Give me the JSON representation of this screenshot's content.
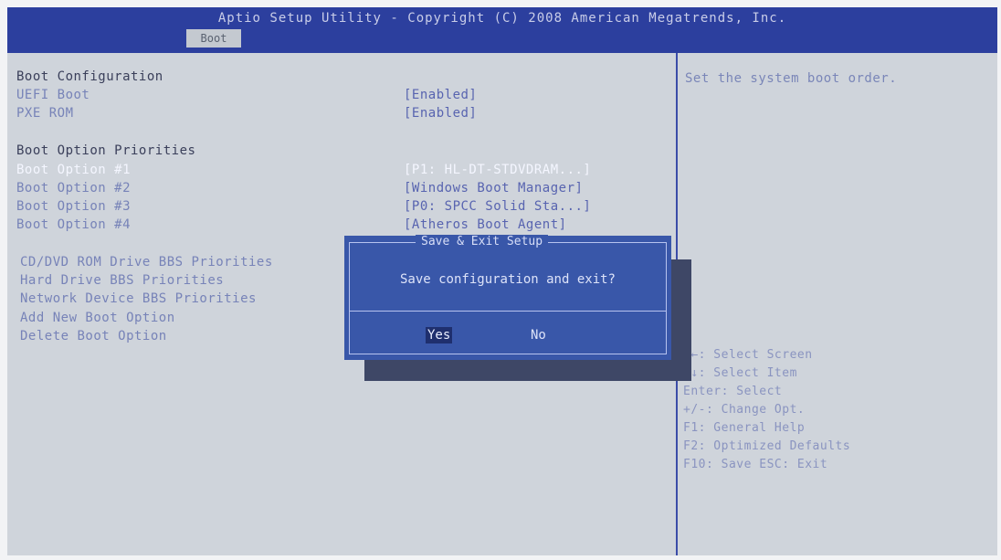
{
  "header": {
    "title": "Aptio Setup Utility - Copyright (C) 2008 American Megatrends, Inc.",
    "active_tab": "Boot"
  },
  "left": {
    "boot_config_heading": "Boot Configuration",
    "uefi_boot": {
      "label": "UEFI Boot",
      "value": "[Enabled]"
    },
    "pxe_rom": {
      "label": "PXE ROM",
      "value": "[Enabled]"
    },
    "priorities_heading": "Boot Option Priorities",
    "boot_options": [
      {
        "label": "Boot Option #1",
        "value": "[P1: HL-DT-STDVDRAM...]"
      },
      {
        "label": "Boot Option #2",
        "value": "[Windows Boot Manager]"
      },
      {
        "label": "Boot Option #3",
        "value": "[P0: SPCC Solid Sta...]"
      },
      {
        "label": "Boot Option #4",
        "value": "[Atheros Boot Agent]"
      }
    ],
    "submenus": [
      "CD/DVD ROM Drive BBS Priorities",
      "Hard Drive BBS Priorities",
      "Network Device BBS Priorities",
      "Add New Boot Option",
      "Delete Boot Option"
    ]
  },
  "help": {
    "text": "Set the system boot order.",
    "keys": [
      "→←: Select Screen",
      "↑↓: Select Item",
      "Enter: Select",
      "+/-: Change Opt.",
      "F1: General Help",
      "F2: Optimized Defaults",
      "F10: Save  ESC: Exit"
    ]
  },
  "dialog": {
    "title": "Save & Exit Setup",
    "message": "Save configuration and exit?",
    "yes_label": "Yes",
    "no_label": "No"
  }
}
